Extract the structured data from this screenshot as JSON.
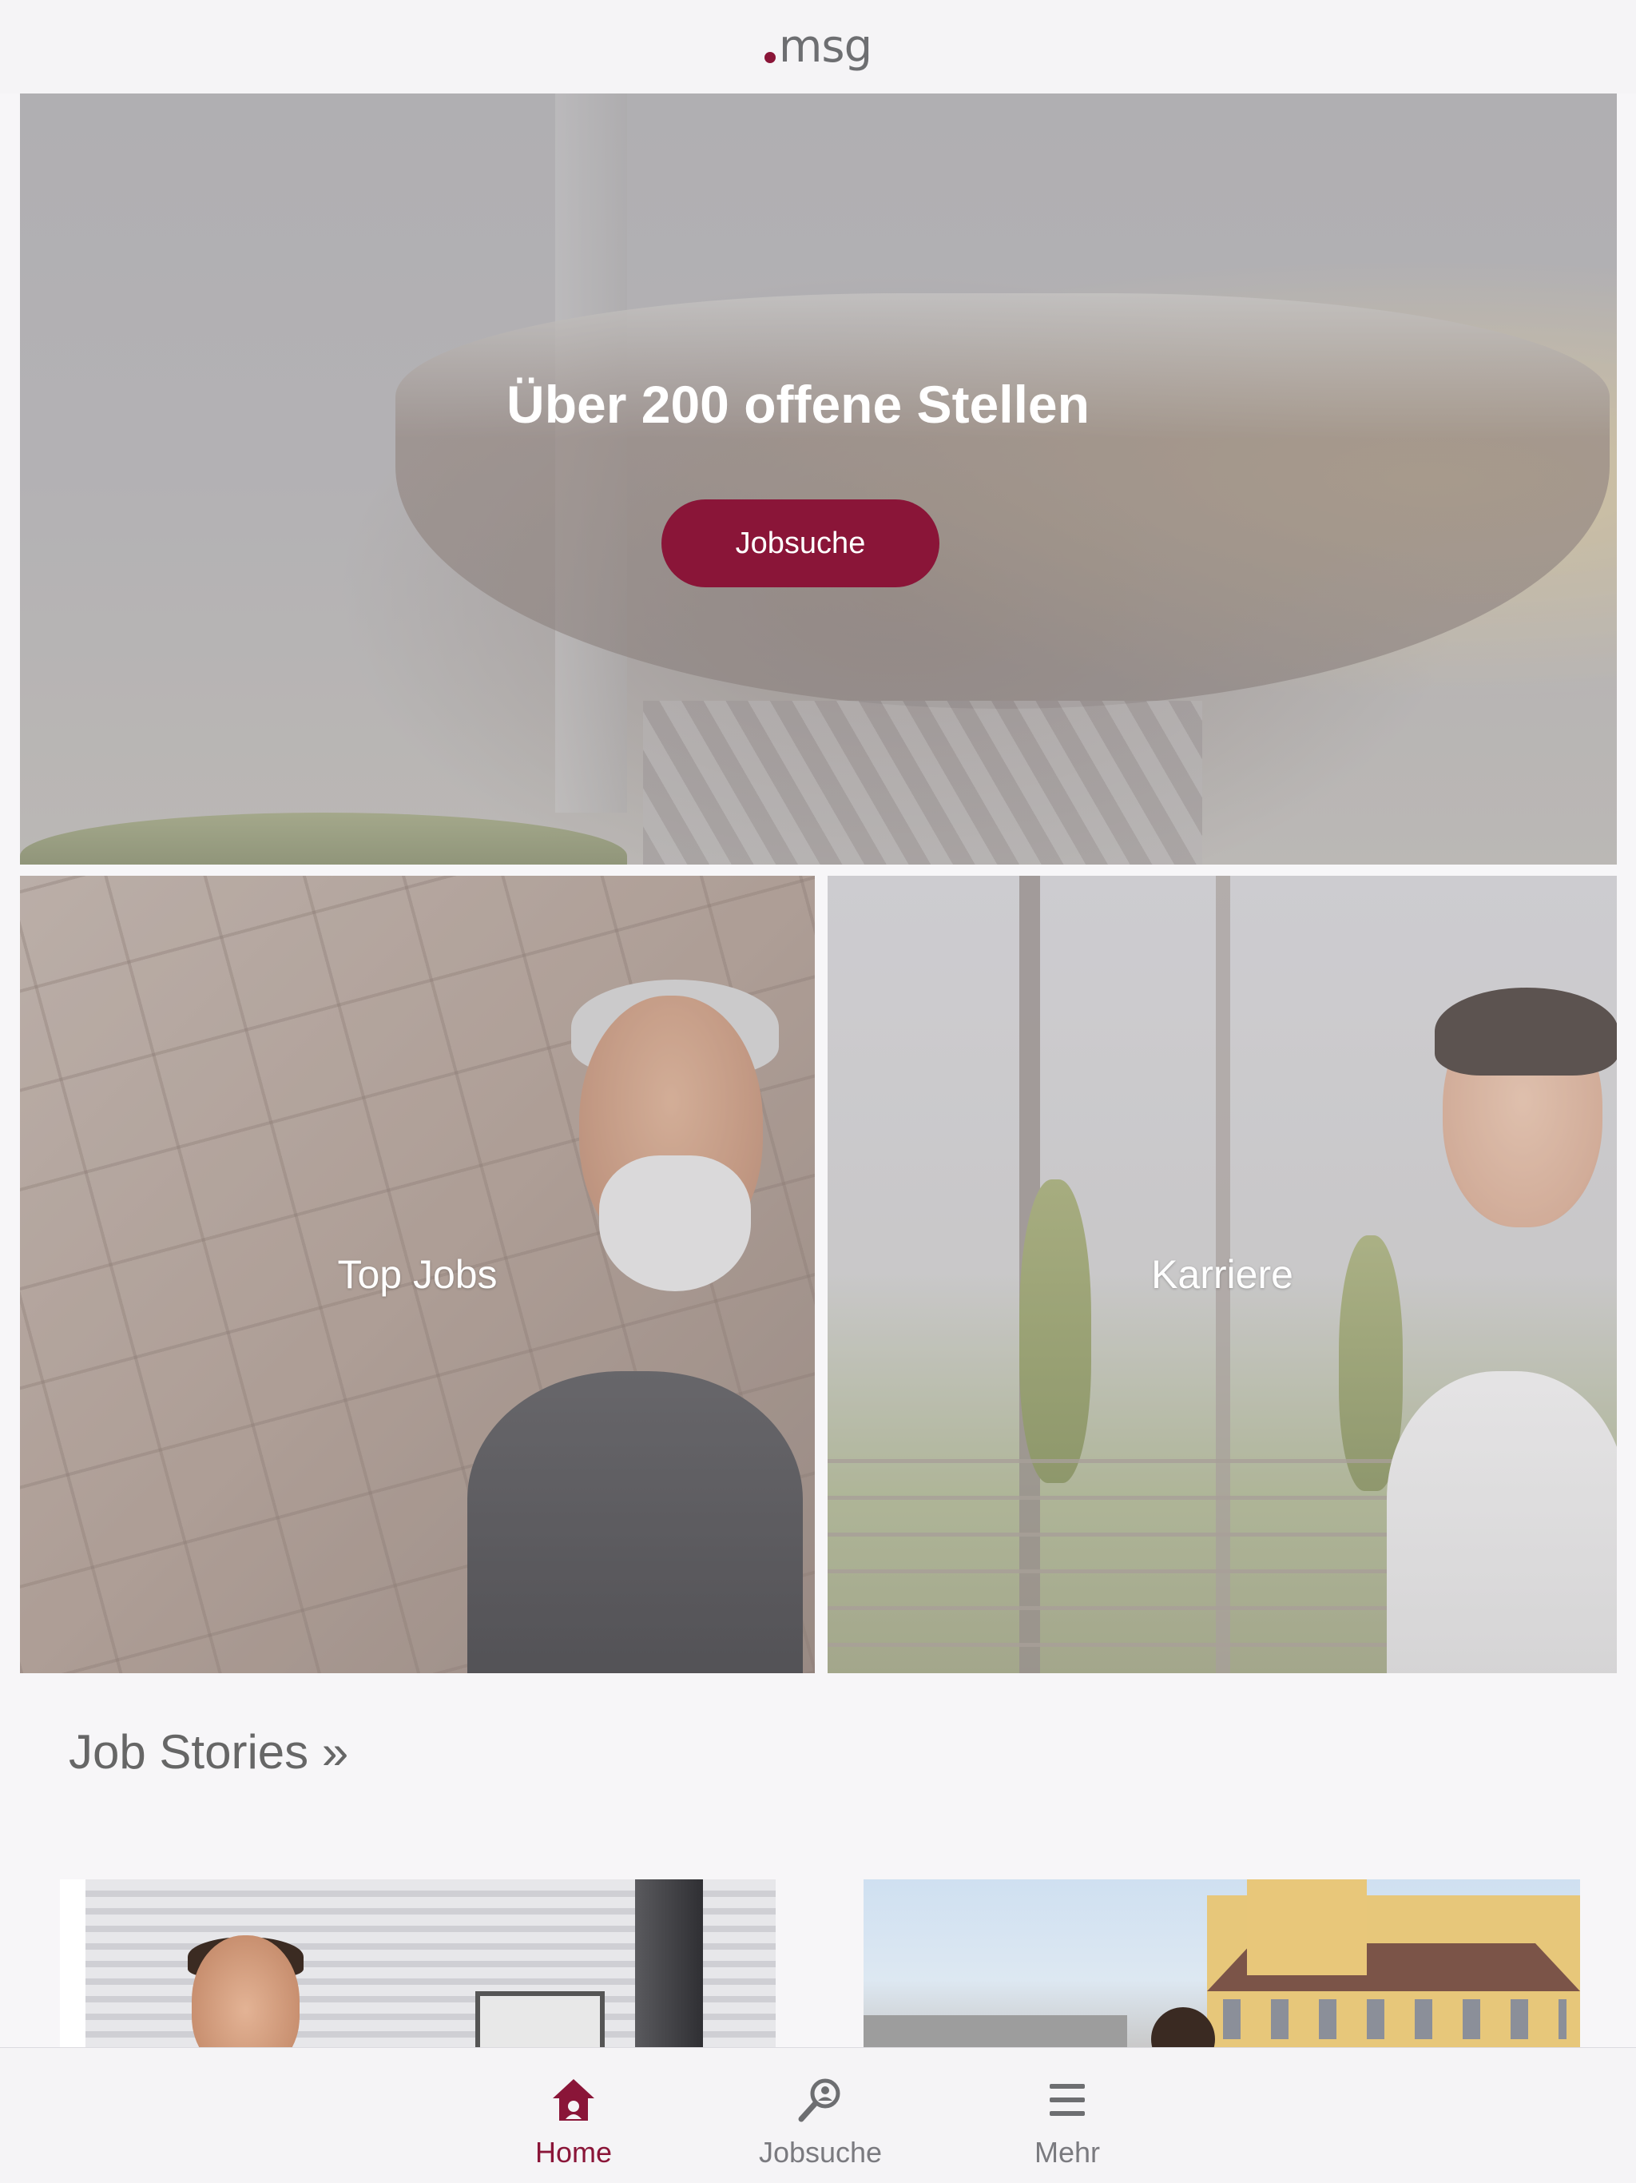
{
  "header": {
    "logo_text": "msg",
    "brand_color": "#8a1538"
  },
  "hero": {
    "title": "Über 200 offene Stellen",
    "button_label": "Jobsuche"
  },
  "tiles": [
    {
      "label": "Top Jobs"
    },
    {
      "label": "Karriere"
    }
  ],
  "stories": {
    "heading": "Job Stories »"
  },
  "tabbar": {
    "active": "Home",
    "active_color": "#8a1538",
    "inactive_color": "#7a7a7f",
    "items": [
      {
        "label": "Home",
        "icon": "home-icon"
      },
      {
        "label": "Jobsuche",
        "icon": "search-person-icon"
      },
      {
        "label": "Mehr",
        "icon": "menu-icon"
      }
    ]
  }
}
